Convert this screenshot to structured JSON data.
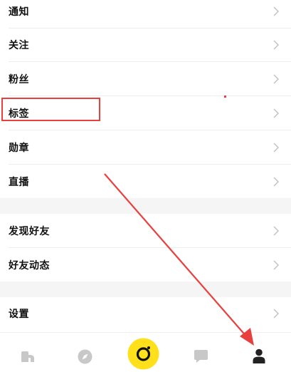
{
  "menu": {
    "items": [
      {
        "label": "通知"
      },
      {
        "label": "关注"
      },
      {
        "label": "粉丝"
      },
      {
        "label": "标签"
      },
      {
        "label": "勋章"
      },
      {
        "label": "直播"
      },
      {
        "label": "发现好友"
      },
      {
        "label": "好友动态"
      },
      {
        "label": "设置"
      }
    ]
  },
  "tabbar": {
    "tabs": [
      {
        "icon": "home-n-icon"
      },
      {
        "icon": "compass-icon"
      },
      {
        "icon": "camera-icon"
      },
      {
        "icon": "chat-bubble-icon"
      },
      {
        "icon": "person-icon"
      }
    ]
  },
  "colors": {
    "annotation": "#e8403e",
    "camera_button": "#ffe01b",
    "icon_gray": "#c8c8c8",
    "icon_active": "#222222"
  }
}
